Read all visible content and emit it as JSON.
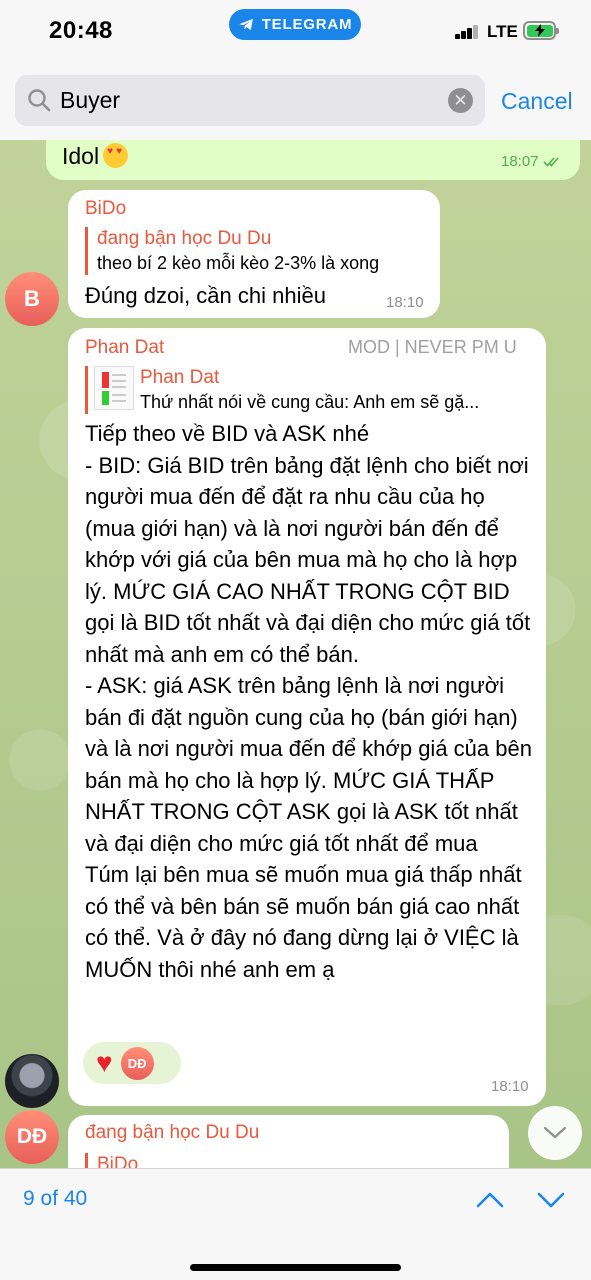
{
  "status_bar": {
    "time": "20:48",
    "app_pill": "TELEGRAM",
    "network": "LTE"
  },
  "search": {
    "query": "Buyer",
    "cancel_label": "Cancel"
  },
  "messages": [
    {
      "type": "outgoing",
      "text": "Idol",
      "emoji": "smiling-face-with-heart-eyes",
      "time": "18:07"
    },
    {
      "type": "incoming",
      "sender": "BiDo",
      "avatar_initials": "B",
      "reply_to": {
        "name": "đang bận học Du Du",
        "text": "theo bí 2 kèo mỗi kèo 2-3% là xong"
      },
      "text": "Đúng dzoi, cần chi nhiều",
      "time": "18:10"
    },
    {
      "type": "incoming",
      "sender": "Phan Dat",
      "badge": "MOD | NEVER PM U",
      "reply_to": {
        "name": "Phan Dat",
        "text": "Thứ nhất nói về cung cầu: Anh em sẽ gặ..."
      },
      "text": "Tiếp theo về BID và ASK nhé\n- BID: Giá BID trên bảng đặt lệnh cho biết nơi người mua đến để đặt ra nhu cầu của họ (mua giới  hạn) và là nơi người bán đến để khớp với giá của bên mua mà họ cho là hợp lý. MỨC GIÁ CAO NHẤT TRONG CỘT BID gọi là BID tốt nhất và đại diện cho mức giá tốt nhất mà anh em có thể bán.\n- ASK:  giá ASK trên bảng lệnh là nơi người bán đi đặt nguồn cung của họ (bán giới hạn) và là nơi người mua đến để khớp giá của bên bán mà họ cho là hợp lý. MỨC GIÁ THẤP NHẤT TRONG CỘT ASK gọi là ASK tốt nhất và đại diện cho mức giá tốt nhất để mua\nTúm lại bên mua sẽ muốn mua giá thấp nhất có thể và bên bán sẽ muốn bán giá cao nhất có thể. Và ở đây nó đang dừng lại ở VIỆC là MUỐN thôi nhé anh em ạ",
      "reactions": {
        "emoji": "heart",
        "reactor_initials": "DĐ"
      },
      "time": "18:10"
    },
    {
      "type": "incoming",
      "sender": "đang bận học Du Du",
      "avatar_initials": "DĐ",
      "reply_to": {
        "name": "BiDo"
      }
    }
  ],
  "bottom_bar": {
    "result_counter": "9 of 40"
  },
  "colors": {
    "accent": "#1a86ea",
    "sender_name": "#e8593e",
    "outgoing_bubble": "#e1fec6",
    "chat_wallpaper": "#b9cc92"
  }
}
